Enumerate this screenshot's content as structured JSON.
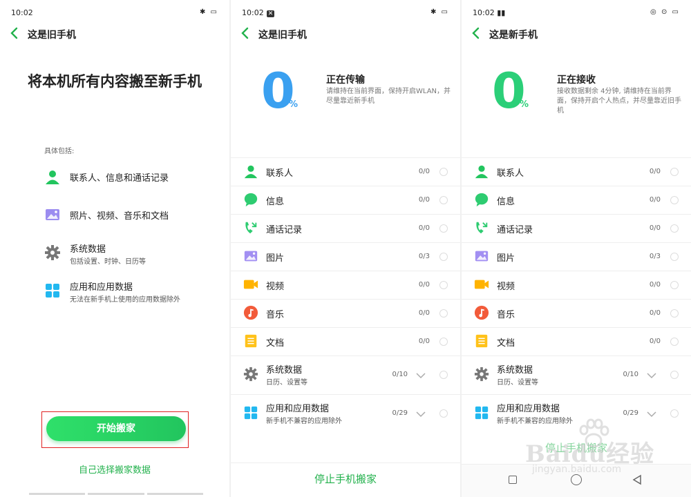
{
  "colors": {
    "accent_green": "#22b14c",
    "blue_percent": "#3aa0f0",
    "green_percent": "#2bcf78",
    "highlight_red": "#e02020"
  },
  "panel_old": {
    "status": {
      "time": "10:02"
    },
    "title": "这是旧手机",
    "hero": "将本机所有内容搬至新手机",
    "includes_label": "具体包括:",
    "items": [
      {
        "label": "联系人、信息和通话记录",
        "sub": "",
        "icon": "contact-icon"
      },
      {
        "label": "照片、视频、音乐和文档",
        "sub": "",
        "icon": "photo-icon"
      },
      {
        "label": "系统数据",
        "sub": "包括设置、时钟、日历等",
        "icon": "gear-icon"
      },
      {
        "label": "应用和应用数据",
        "sub": "无法在新手机上使用的应用数据除外",
        "icon": "apps-icon"
      }
    ],
    "start_button": "开始搬家",
    "self_select": "自己选择搬家数据"
  },
  "panel_transfer": {
    "status": {
      "time": "10:02"
    },
    "title": "这是旧手机",
    "percent": "0",
    "percent_sign": "%",
    "state_title": "正在传输",
    "state_desc": "请维持在当前界面，保持开启WLAN，并尽量靠近新手机",
    "rows": [
      {
        "label": "联系人",
        "count": "0/0",
        "icon": "contact-icon"
      },
      {
        "label": "信息",
        "count": "0/0",
        "icon": "message-icon"
      },
      {
        "label": "通话记录",
        "count": "0/0",
        "icon": "call-log-icon"
      },
      {
        "label": "图片",
        "count": "0/3",
        "icon": "picture-icon"
      },
      {
        "label": "视频",
        "count": "0/0",
        "icon": "video-icon"
      },
      {
        "label": "音乐",
        "count": "0/0",
        "icon": "music-icon"
      },
      {
        "label": "文档",
        "count": "0/0",
        "icon": "document-icon"
      },
      {
        "label": "系统数据",
        "sub": "日历、设置等",
        "count": "0/10",
        "icon": "gear-icon"
      },
      {
        "label": "应用和应用数据",
        "sub": "新手机不兼容的应用除外",
        "count": "0/29",
        "icon": "apps-icon"
      }
    ],
    "stop_button": "停止手机搬家"
  },
  "panel_receive": {
    "status": {
      "time": "10:02"
    },
    "title": "这是新手机",
    "percent": "0",
    "percent_sign": "%",
    "state_title": "正在接收",
    "state_desc": "接收数据剩余 4分钟, 请维持在当前界面，保持开启个人热点，并尽量靠近旧手机",
    "rows": [
      {
        "label": "联系人",
        "count": "0/0",
        "icon": "contact-icon"
      },
      {
        "label": "信息",
        "count": "0/0",
        "icon": "message-icon"
      },
      {
        "label": "通话记录",
        "count": "0/0",
        "icon": "call-log-icon"
      },
      {
        "label": "图片",
        "count": "0/3",
        "icon": "picture-icon"
      },
      {
        "label": "视频",
        "count": "0/0",
        "icon": "video-icon"
      },
      {
        "label": "音乐",
        "count": "0/0",
        "icon": "music-icon"
      },
      {
        "label": "文档",
        "count": "0/0",
        "icon": "document-icon"
      },
      {
        "label": "系统数据",
        "sub": "日历、设置等",
        "count": "0/10",
        "icon": "gear-icon"
      },
      {
        "label": "应用和应用数据",
        "sub": "新手机不兼容的应用除外",
        "count": "0/29",
        "icon": "apps-icon"
      }
    ],
    "stop_button": "停止手机搬家"
  },
  "watermark": {
    "brand": "Baidu经验",
    "url": "jingyan.baidu.com"
  }
}
